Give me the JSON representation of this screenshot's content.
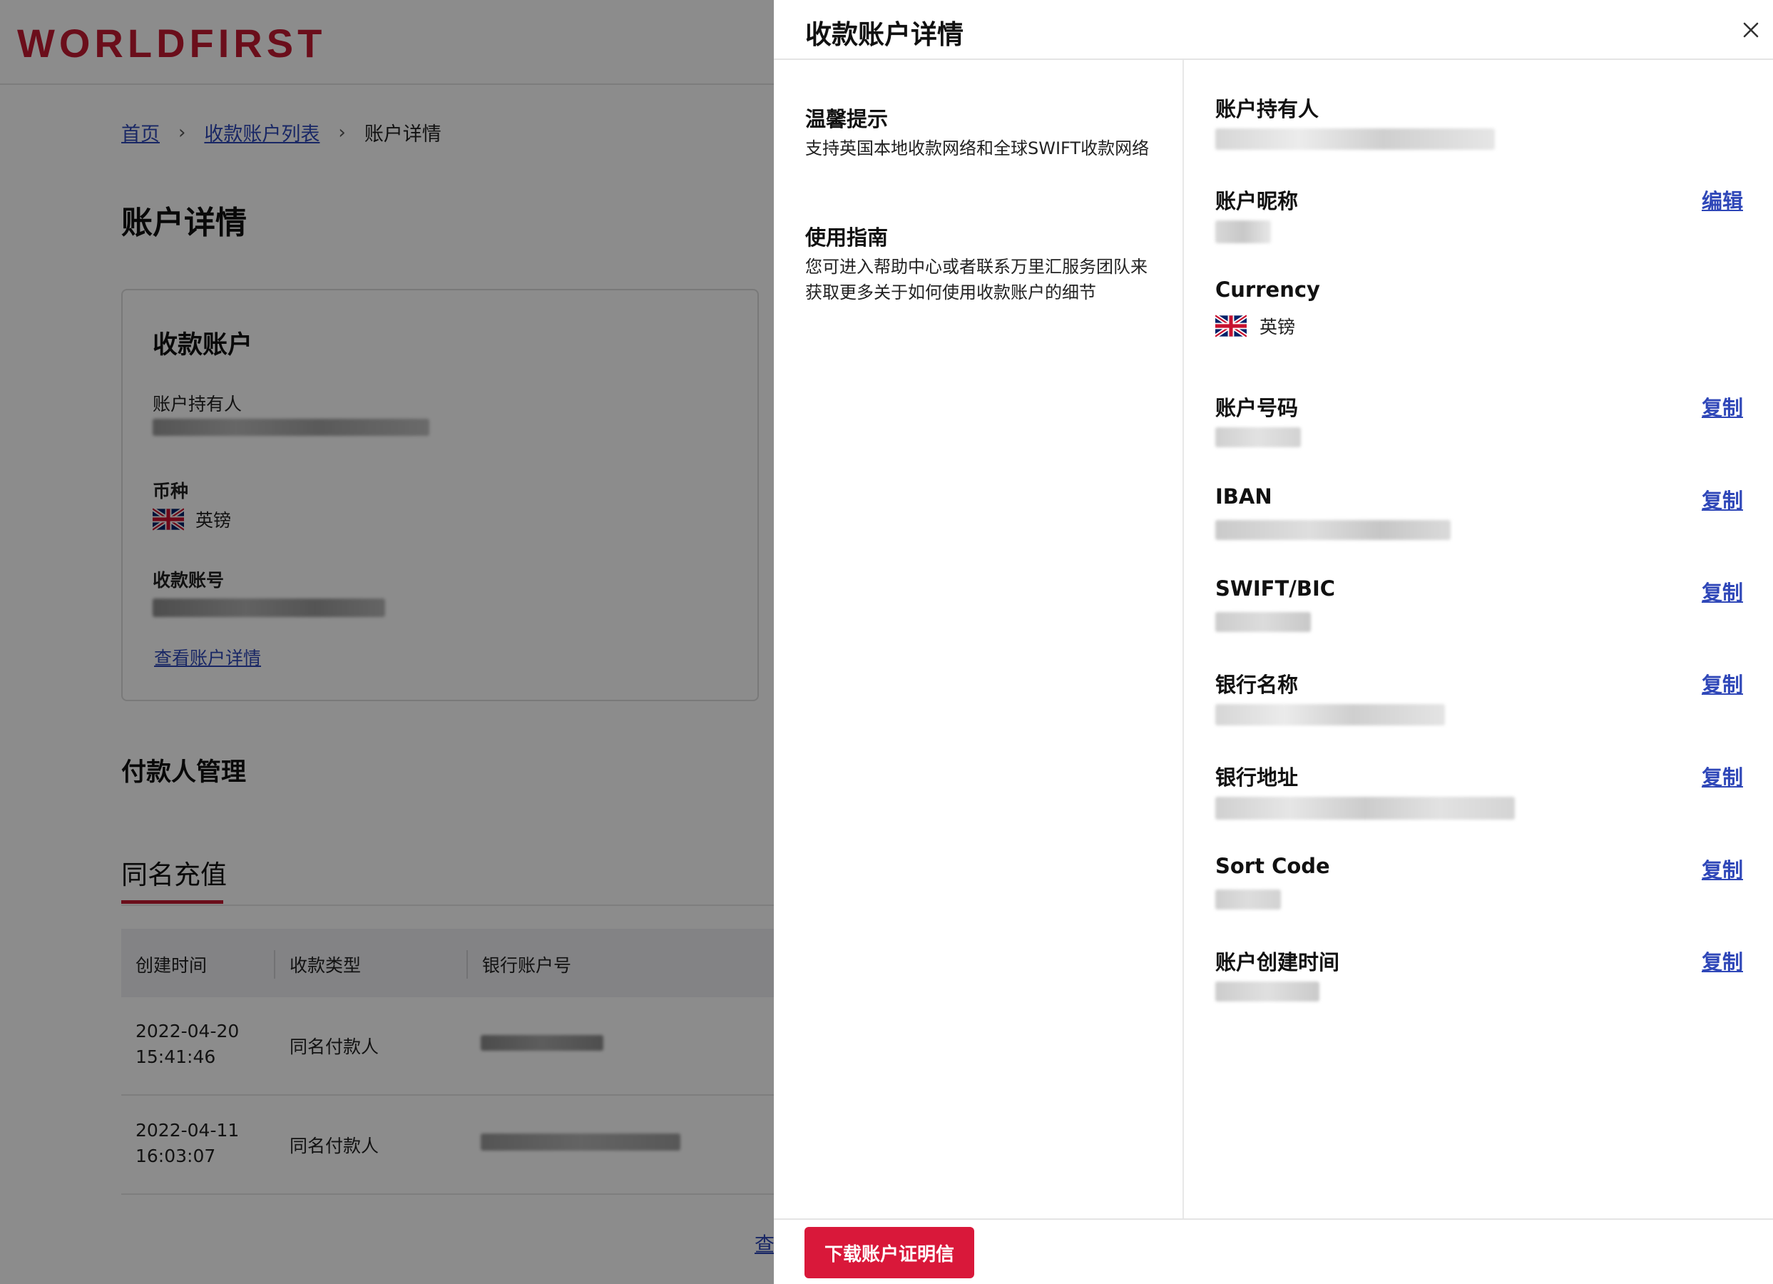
{
  "brand": {
    "logo": "WORLDFIRST",
    "accent": "#c41a32",
    "link": "#2f47b8"
  },
  "breadcrumb": {
    "home": "首页",
    "list": "收款账户列表",
    "current": "账户详情"
  },
  "page_title": "账户详情",
  "account_card": {
    "title": "收款账户",
    "holder_label": "账户持有人",
    "currency_label": "币种",
    "currency_value": "英镑",
    "currency_flag": "uk-flag-icon",
    "account_no_label": "收款账号",
    "view_link": "查看账户详情"
  },
  "payer_section_title": "付款人管理",
  "tabs": [
    {
      "label": "同名充值",
      "active": true
    }
  ],
  "table": {
    "columns": [
      "创建时间",
      "收款类型",
      "银行账户号"
    ],
    "rows": [
      {
        "date": "2022-04-20",
        "time": "15:41:46",
        "type": "同名付款人"
      },
      {
        "date": "2022-04-11",
        "time": "16:03:07",
        "type": "同名付款人"
      }
    ],
    "footer_link": "查"
  },
  "drawer": {
    "title": "收款账户详情",
    "close_icon": "close-icon",
    "tips": [
      {
        "title": "温馨提示",
        "text": "支持英国本地收款网络和全球SWIFT收款网络"
      },
      {
        "title": "使用指南",
        "text": "您可进入帮助中心或者联系万里汇服务团队来获取更多关于如何使用收款账户的细节"
      }
    ],
    "fields": [
      {
        "label": "账户持有人",
        "action": ""
      },
      {
        "label": "账户昵称",
        "action": "编辑"
      },
      {
        "label": "Currency",
        "action": "",
        "value": "英镑"
      },
      {
        "label": "账户号码",
        "action": "复制"
      },
      {
        "label": "IBAN",
        "action": "复制"
      },
      {
        "label": "SWIFT/BIC",
        "action": "复制"
      },
      {
        "label": "银行名称",
        "action": "复制"
      },
      {
        "label": "银行地址",
        "action": "复制"
      },
      {
        "label": "Sort Code",
        "action": "复制"
      },
      {
        "label": "账户创建时间",
        "action": "复制"
      }
    ],
    "download_button": "下载账户证明信"
  }
}
